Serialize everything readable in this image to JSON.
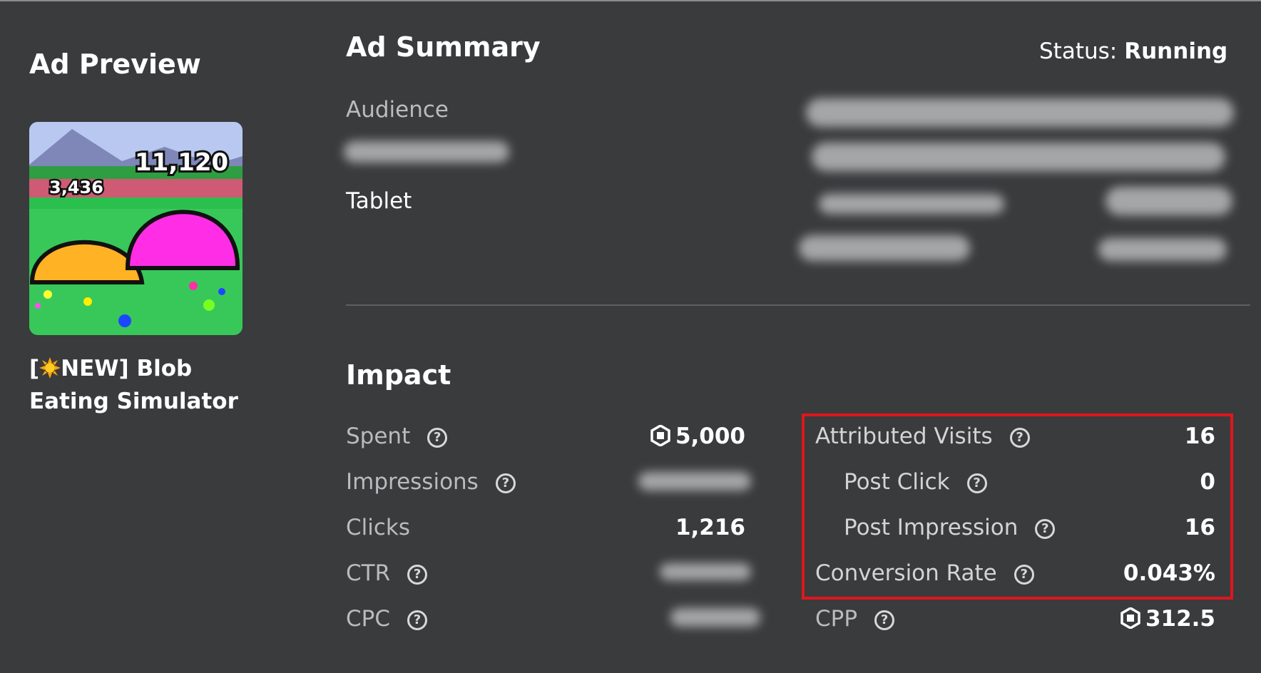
{
  "preview": {
    "heading": "Ad Preview",
    "game_title_prefix": "[",
    "game_title_rest": "NEW] Blob Eating Simulator",
    "thumb_number_left": "3,436",
    "thumb_number_right": "11,120"
  },
  "summary": {
    "heading": "Ad Summary",
    "status_label": "Status:",
    "status_value": "Running",
    "audience_label": "Audience",
    "device": "Tablet"
  },
  "impact": {
    "heading": "Impact",
    "left_rows": [
      {
        "label": "Spent",
        "value": "5,000"
      },
      {
        "label": "Impressions",
        "value": ""
      },
      {
        "label": "Clicks",
        "value": "1,216"
      },
      {
        "label": "CTR",
        "value": ""
      },
      {
        "label": "CPC",
        "value": ""
      }
    ],
    "right_rows": [
      {
        "label": "Attributed Visits",
        "value": "16"
      },
      {
        "label": "Post Click",
        "value": "0"
      },
      {
        "label": "Post Impression",
        "value": "16"
      },
      {
        "label": "Conversion Rate",
        "value": "0.043%"
      },
      {
        "label": "CPP",
        "value": "312.5"
      }
    ]
  },
  "colors": {
    "background": "#393b3d",
    "highlight_border": "#e0161c",
    "muted_text": "#b9bbbd"
  }
}
